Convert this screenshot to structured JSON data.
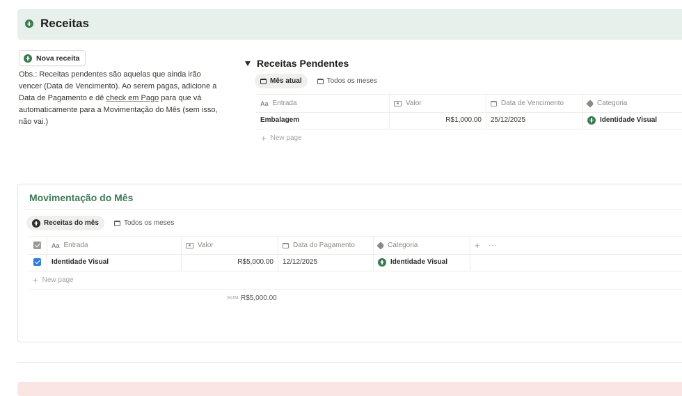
{
  "header": {
    "title": "Receitas",
    "icon": "plus-circle-icon",
    "accent": "#2f6b45"
  },
  "new_button": {
    "label": "Nova receita"
  },
  "obs": {
    "before": "Obs.: Receitas pendentes são aquelas que ainda irão vencer (Data de Vencimento). Ao serem pagas, adicione a Data de Pagamento e dê ",
    "link": "check em Pago",
    "after": " para que vá automaticamente para a Movimentação do Mês (sem isso, não vai.)"
  },
  "pending": {
    "title": "Receitas Pendentes",
    "tabs": [
      {
        "label": "Mês atual",
        "active": true
      },
      {
        "label": "Todos os meses",
        "active": false
      }
    ],
    "columns": {
      "entrada": "Entrada",
      "valor": "Valor",
      "data": "Data de Vencimento",
      "categoria": "Categoria"
    },
    "rows": [
      {
        "entrada": "Embalagem",
        "valor": "R$1,000.00",
        "data": "25/12/2025",
        "categoria": "Identidade Visual"
      }
    ],
    "new_page": "New page"
  },
  "movement": {
    "title": "Movimentação do Mês",
    "tabs": [
      {
        "label": "Receitas do mês",
        "active": true
      },
      {
        "label": "Todos os meses",
        "active": false
      }
    ],
    "columns": {
      "entrada": "Entrada",
      "valor": "Valor",
      "data": "Data do Pagamento",
      "categoria": "Categoria",
      "add": "+",
      "more": "···"
    },
    "rows": [
      {
        "pago": true,
        "entrada": "Identidade Visual",
        "valor": "R$5,000.00",
        "data": "12/12/2025",
        "categoria": "Identidade Visual"
      }
    ],
    "new_page": "New page",
    "sum_label": "SUM",
    "sum_value": "R$5,000.00"
  }
}
